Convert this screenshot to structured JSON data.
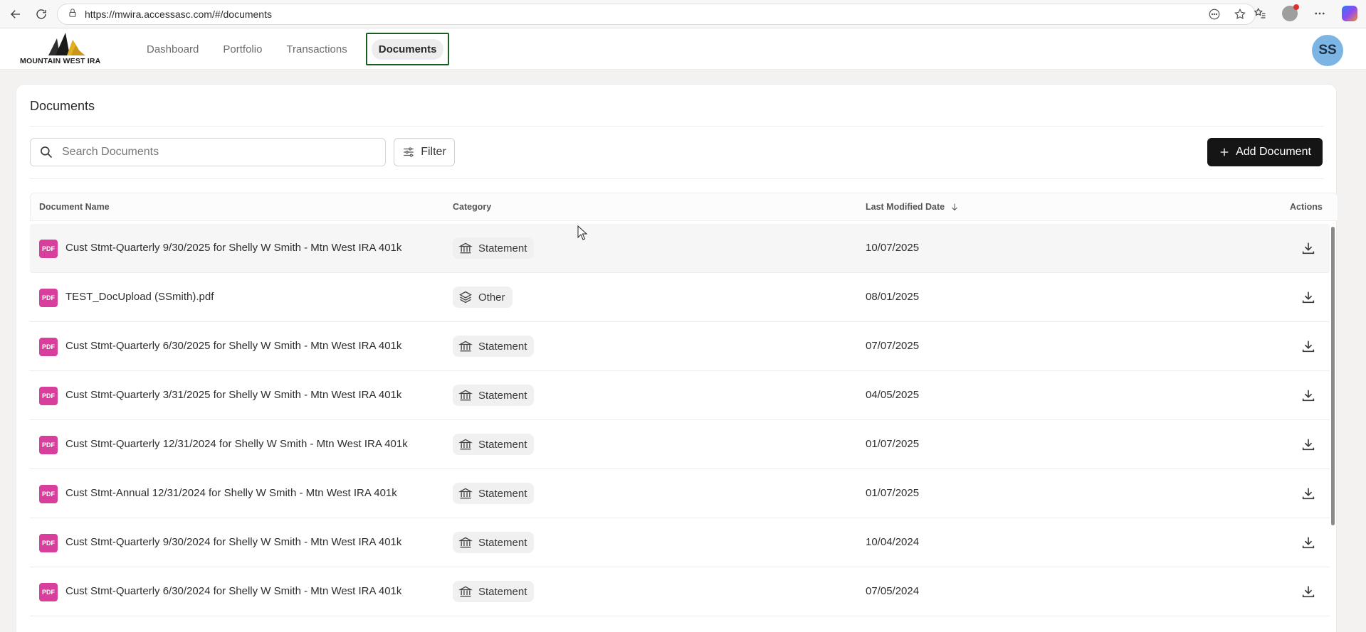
{
  "browser": {
    "url": "https://mwira.accessasc.com/#/documents"
  },
  "header": {
    "logo_text": "MOUNTAIN WEST IRA",
    "nav": [
      {
        "label": "Dashboard"
      },
      {
        "label": "Portfolio"
      },
      {
        "label": "Transactions"
      },
      {
        "label": "Documents",
        "active": true
      }
    ],
    "avatar_initials": "SS",
    "avatar_color": "#7cb4e4",
    "active_outline_color": "#1a5e1f"
  },
  "page": {
    "title": "Documents",
    "search_placeholder": "Search Documents",
    "filter_label": "Filter",
    "add_label": "Add Document"
  },
  "table": {
    "columns": {
      "name": "Document Name",
      "category": "Category",
      "date": "Last Modified Date",
      "actions": "Actions"
    },
    "sort": {
      "column": "date",
      "direction": "desc"
    },
    "rows": [
      {
        "icon": "PDF",
        "name": "Cust Stmt-Quarterly 9/30/2025 for Shelly W Smith - Mtn West IRA 401k",
        "category": "Statement",
        "category_icon": "bank-icon",
        "date": "10/07/2025"
      },
      {
        "icon": "PDF",
        "name": "TEST_DocUpload (SSmith).pdf",
        "category": "Other",
        "category_icon": "layers-icon",
        "date": "08/01/2025"
      },
      {
        "icon": "PDF",
        "name": "Cust Stmt-Quarterly 6/30/2025 for Shelly W Smith - Mtn West IRA 401k",
        "category": "Statement",
        "category_icon": "bank-icon",
        "date": "07/07/2025"
      },
      {
        "icon": "PDF",
        "name": "Cust Stmt-Quarterly 3/31/2025 for Shelly W Smith - Mtn West IRA 401k",
        "category": "Statement",
        "category_icon": "bank-icon",
        "date": "04/05/2025"
      },
      {
        "icon": "PDF",
        "name": "Cust Stmt-Quarterly 12/31/2024 for Shelly W Smith - Mtn West IRA 401k",
        "category": "Statement",
        "category_icon": "bank-icon",
        "date": "01/07/2025"
      },
      {
        "icon": "PDF",
        "name": "Cust Stmt-Annual 12/31/2024 for Shelly W Smith - Mtn West IRA 401k",
        "category": "Statement",
        "category_icon": "bank-icon",
        "date": "01/07/2025"
      },
      {
        "icon": "PDF",
        "name": "Cust Stmt-Quarterly 9/30/2024 for Shelly W Smith - Mtn West IRA 401k",
        "category": "Statement",
        "category_icon": "bank-icon",
        "date": "10/04/2024"
      },
      {
        "icon": "PDF",
        "name": "Cust Stmt-Quarterly 6/30/2024 for Shelly W Smith - Mtn West IRA 401k",
        "category": "Statement",
        "category_icon": "bank-icon",
        "date": "07/05/2024"
      }
    ]
  },
  "colors": {
    "pdf_badge": "#d83f9c",
    "primary_button": "#151515"
  }
}
